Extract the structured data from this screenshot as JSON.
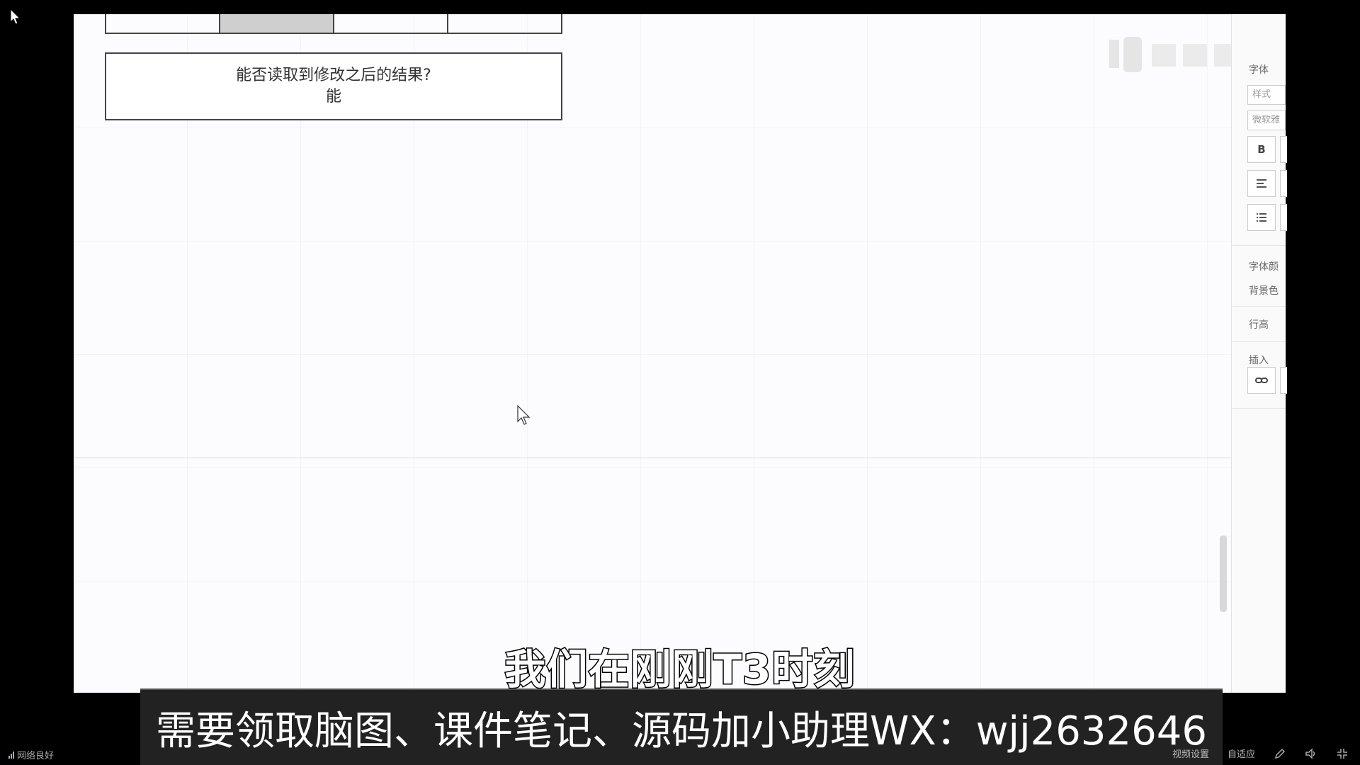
{
  "canvas": {
    "note_line1": "能否读取到修改之后的结果?",
    "note_line2": "能"
  },
  "right_panel": {
    "font_heading": "字体",
    "style_placeholder": "样式",
    "font_value": "微软雅",
    "bold_label": "B",
    "font_color_label": "字体颜",
    "bg_color_label": "背景色",
    "line_height_label": "行高",
    "insert_label": "插入"
  },
  "subtitle": "我们在刚刚T3时刻",
  "banner": "需要领取脑图、课件笔记、源码加小助理WX：wjj2632646",
  "player": {
    "network_status": "网络良好",
    "video_settings": "视频设置",
    "fit_label": "自适应"
  }
}
